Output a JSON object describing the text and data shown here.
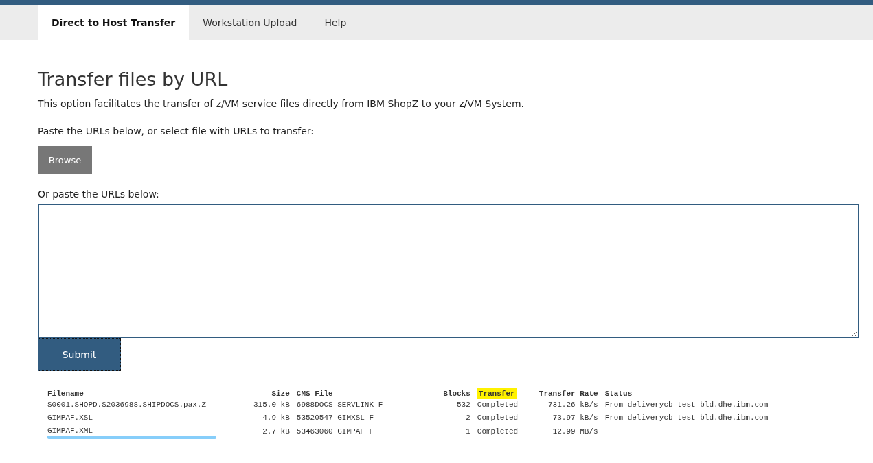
{
  "tabs": [
    {
      "label": "Direct to Host Transfer",
      "selected": true
    },
    {
      "label": "Workstation Upload",
      "selected": false
    },
    {
      "label": "Help",
      "selected": false
    }
  ],
  "heading": "Transfer files by URL",
  "intro": "This option facilitates the transfer of z/VM service files directly from IBM ShopZ to your z/VM System.",
  "paste_prompt": "Paste the URLs below, or select file with URLs to transfer:",
  "browse_button": "Browse",
  "urls_label": "Or paste the URLs below:",
  "submit_button": "Submit",
  "table": {
    "columns": [
      {
        "label": "Filename",
        "highlighted": false
      },
      {
        "label": "Size",
        "highlighted": false
      },
      {
        "label": "CMS File",
        "highlighted": false
      },
      {
        "label": "Blocks",
        "highlighted": false
      },
      {
        "label": "Transfer",
        "highlighted": true
      },
      {
        "label": "Transfer Rate",
        "highlighted": false
      },
      {
        "label": "Status",
        "highlighted": false
      }
    ],
    "rows": [
      {
        "cells": [
          "S0001.SHOPD.S2036988.SHIPDOCS.pax.Z",
          "315.0 kB",
          "6988DOCS SERVLINK F",
          "532",
          "Completed",
          "731.26 kB/s",
          "From deliverycb-test-bld.dhe.ibm.com"
        ],
        "underlined": false
      },
      {
        "cells": [
          "GIMPAF.XSL",
          "4.9 kB",
          "53520547 GIMXSL F",
          "2",
          "Completed",
          "73.97 kB/s",
          "From deliverycb-test-bld.dhe.ibm.com"
        ],
        "underlined": false
      },
      {
        "cells": [
          "GIMPAF.XML",
          "2.7 kB",
          "53463060 GIMPAF F",
          "1",
          "Completed",
          "12.99 MB/s",
          ""
        ],
        "underlined": true
      }
    ]
  }
}
